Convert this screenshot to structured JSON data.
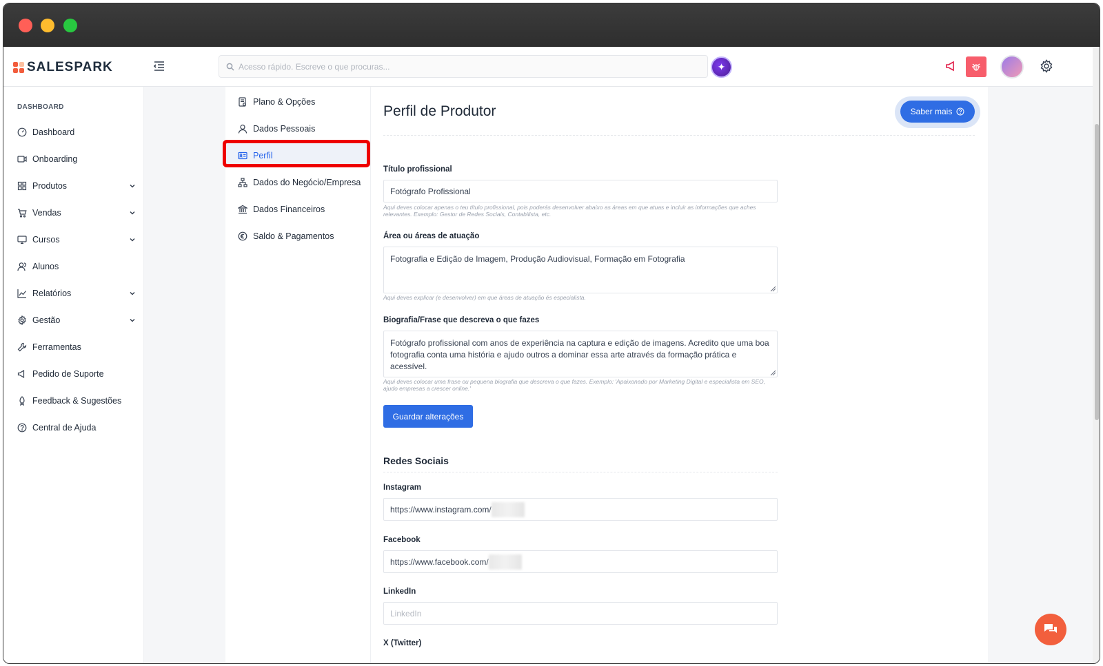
{
  "app": {
    "logo_text": "SALESPARK",
    "brand_color": "#f25c3c",
    "accent_color": "#2f6de4"
  },
  "search": {
    "placeholder": "Acesso rápido. Escreve o que procuras..."
  },
  "sidebar": {
    "heading": "DASHBOARD",
    "items": [
      {
        "label": "Dashboard",
        "icon": "gauge-icon",
        "expandable": false
      },
      {
        "label": "Onboarding",
        "icon": "video-icon",
        "expandable": false
      },
      {
        "label": "Produtos",
        "icon": "grid-icon",
        "expandable": true
      },
      {
        "label": "Vendas",
        "icon": "cart-icon",
        "expandable": true
      },
      {
        "label": "Cursos",
        "icon": "monitor-icon",
        "expandable": true
      },
      {
        "label": "Alunos",
        "icon": "users-icon",
        "expandable": false
      },
      {
        "label": "Relatórios",
        "icon": "chart-icon",
        "expandable": true
      },
      {
        "label": "Gestão",
        "icon": "gear-icon",
        "expandable": true
      },
      {
        "label": "Ferramentas",
        "icon": "wrench-icon",
        "expandable": false
      },
      {
        "label": "Pedido de Suporte",
        "icon": "megaphone-icon",
        "expandable": false
      },
      {
        "label": "Feedback & Sugestões",
        "icon": "rocket-icon",
        "expandable": false
      },
      {
        "label": "Central de Ajuda",
        "icon": "help-circle-icon",
        "expandable": false
      }
    ]
  },
  "submenu": {
    "items": [
      {
        "label": "Plano & Opções",
        "icon": "document-icon"
      },
      {
        "label": "Dados Pessoais",
        "icon": "user-icon"
      },
      {
        "label": "Perfil",
        "icon": "id-card-icon",
        "active": true
      },
      {
        "label": "Dados do Negócio/Empresa",
        "icon": "sitemap-icon"
      },
      {
        "label": "Dados Financeiros",
        "icon": "bank-icon"
      },
      {
        "label": "Saldo & Pagamentos",
        "icon": "euro-icon"
      }
    ]
  },
  "main": {
    "title": "Perfil de Produtor",
    "saber_mais_label": "Saber mais",
    "form": {
      "titulo_label": "Título profissional",
      "titulo_value": "Fotógrafo Profissional",
      "titulo_hint": "Aqui deves colocar apenas o teu título profissional, pois poderás desenvolver abaixo as áreas em que atuas e incluir as informações que aches relevantes. Exemplo: Gestor de Redes Sociais, Contabilista, etc.",
      "area_label": "Área ou áreas de atuação",
      "area_value": "Fotografia e Edição de Imagem, Produção Audiovisual, Formação em Fotografia",
      "area_hint": "Aqui deves explicar (e desenvolver) em que áreas de atuação és especialista.",
      "bio_label": "Biografia/Frase que descreva o que fazes",
      "bio_value": "Fotógrafo profissional com anos de experiência na captura e edição de imagens. Acredito que uma boa fotografia conta uma história e ajudo outros a dominar essa arte através da formação prática e acessível.",
      "bio_hint": "Aqui deves colocar uma frase ou pequena biografia que descreva o que fazes. Exemplo: 'Apaixonado por Marketing Digital e especialista em SEO, ajudo empresas a crescer online.'",
      "save_label": "Guardar alterações"
    },
    "social": {
      "title": "Redes Sociais",
      "instagram_label": "Instagram",
      "instagram_value": "https://www.instagram.com/",
      "facebook_label": "Facebook",
      "facebook_value": "https://www.facebook.com/",
      "linkedin_label": "LinkedIn",
      "linkedin_placeholder": "LinkedIn",
      "twitter_label": "X (Twitter)"
    }
  }
}
